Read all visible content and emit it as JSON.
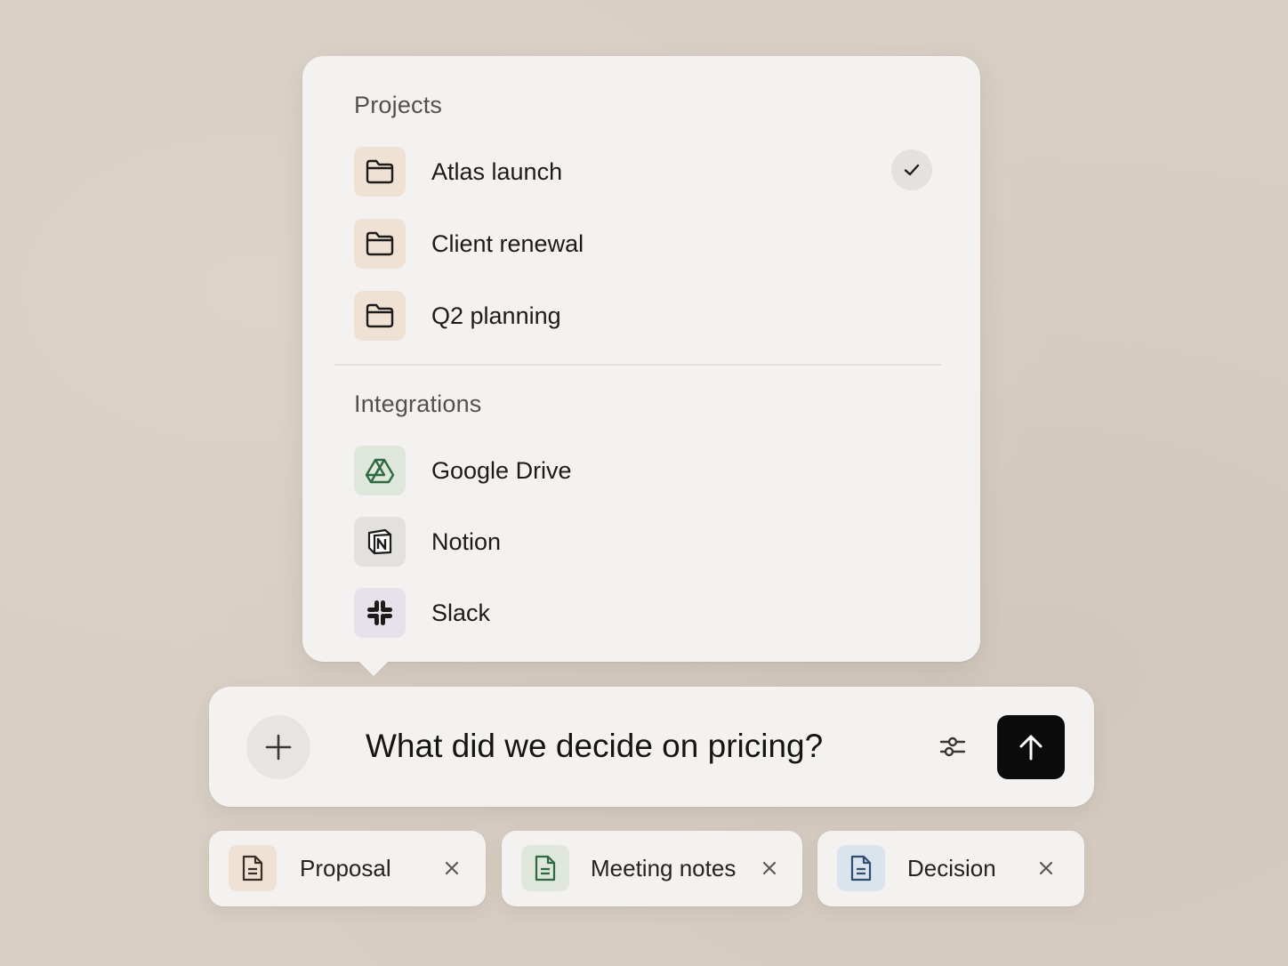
{
  "menu": {
    "projects_heading": "Projects",
    "projects": [
      {
        "label": "Atlas launch",
        "icon": "folder-icon",
        "selected": true
      },
      {
        "label": "Client renewal",
        "icon": "folder-icon",
        "selected": false
      },
      {
        "label": "Q2 planning",
        "icon": "folder-icon",
        "selected": false
      }
    ],
    "integrations_heading": "Integrations",
    "integrations": [
      {
        "label": "Google Drive",
        "icon": "google-drive-icon"
      },
      {
        "label": "Notion",
        "icon": "notion-icon"
      },
      {
        "label": "Slack",
        "icon": "slack-icon"
      }
    ]
  },
  "composer": {
    "add_icon": "plus-icon",
    "prompt_value": "What did we decide on pricing?",
    "settings_icon": "sliders-icon",
    "send_icon": "arrow-up-icon"
  },
  "attachments": [
    {
      "label": "Proposal",
      "icon": "document-icon",
      "color": "#8a6a4e"
    },
    {
      "label": "Meeting notes",
      "icon": "document-icon",
      "color": "#3f7a4f"
    },
    {
      "label": "Decision",
      "icon": "document-icon",
      "color": "#3e5f86"
    }
  ],
  "colors": {
    "background": "#d8cec3",
    "panel": "#f3f2f0",
    "send_button": "#0b0b0b"
  }
}
